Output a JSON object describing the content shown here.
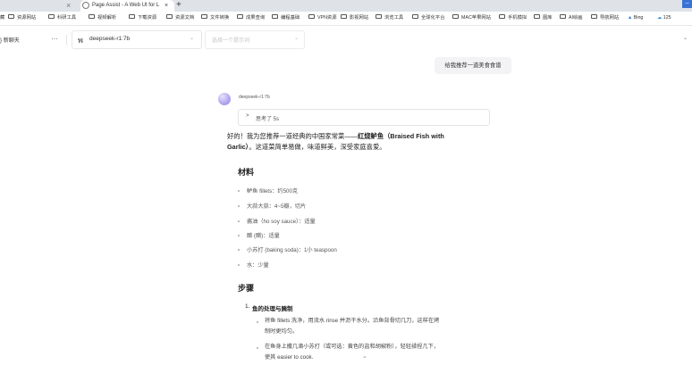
{
  "browser": {
    "tab_title": "Page Assist - A Web UI for L",
    "tab_close_icon": "×",
    "new_tab_icon": "+",
    "bookmarks": [
      "资源网站",
      "科研工具",
      "视频解析",
      "下载资源",
      "资源文档",
      "文件转换",
      "成果查询",
      "编程基础",
      "VPN资源",
      "影视网站",
      "浏览工具",
      "全球化平台",
      "MAC苹果网站",
      "手机模拟",
      "图库",
      "AI绘画",
      "导航网站"
    ],
    "bookmark_bing": "Bing",
    "bookmark_last": "125"
  },
  "controls": {
    "new_chat_label": "新聊天",
    "more_icon": "…",
    "model_name": "deepseek-r1:7b",
    "prompt_placeholder": "选择一个提示词"
  },
  "chat": {
    "user_message": "给我推荐一道美食食谱",
    "assistant_name": "deepseek-r1:7b",
    "thought_label": "思考了 5s",
    "intro_line1_prefix": "好的！我为您推荐一道经典的中国家常菜——",
    "intro_line1_bold": "红烧鲈鱼（Braised Fish with",
    "intro_line2_bold": "Garlic）",
    "intro_line2_rest": "。这道菜简单易做，味道鲜美，深受家庭喜爱。",
    "ingredients_heading": "材料",
    "ingredients": [
      "鲈鱼 fillets：约500克",
      "大蒜大蒜：4~5瓣，切片",
      "酱油（ho soy sauce）：适量",
      "醋 (醋)：适量",
      "小苏打 (baking soda)：1小 teaspoon",
      "水：少量"
    ],
    "steps_heading": "步骤",
    "step1_number": "1.",
    "step1_title": "鱼的处理与腌制",
    "step1_sub1_line1": "将鱼 fillets 洗净，用流水 rinse 并沥干水分。沿鱼背骨切几刀，这样在烤",
    "step1_sub1_line2": "制时更均匀。",
    "step1_sub2_line1": "在鱼身上撒几滴小苏打（或可选：黄色的盐和胡椒粉），轻轻揉捏几下，",
    "step1_sub2_line2": "使其 easier to cook."
  }
}
